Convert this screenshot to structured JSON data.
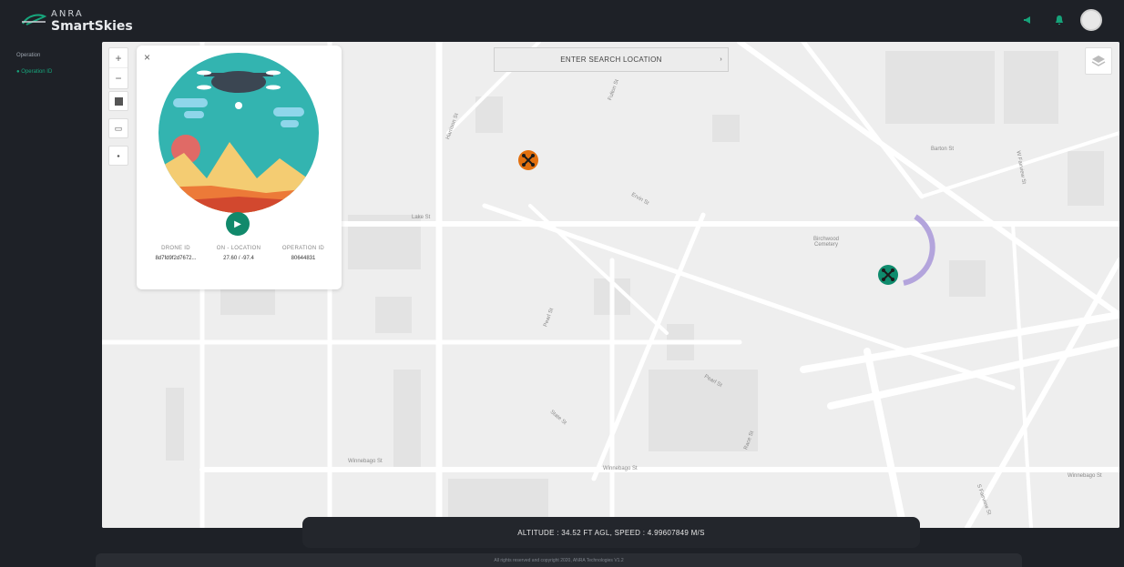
{
  "brand": {
    "line1": "ANRA",
    "line2": "SmartSkies"
  },
  "topbar": {
    "icons": [
      "megaphone-icon",
      "bell-icon"
    ],
    "accent": "#16a37a"
  },
  "sidebar": {
    "title": "Operation",
    "items": [
      {
        "label": "● Operation ID"
      }
    ]
  },
  "map": {
    "search_label": "ENTER SEARCH LOCATION",
    "streets": [
      "Lake St",
      "Winnebago St",
      "Winnebago St",
      "Pearl St",
      "Ervin St",
      "Barton St",
      "W Fairview St",
      "S Fairview St",
      "Harrison St",
      "Pearl St",
      "State St",
      "Fulton St",
      "Race St",
      "Winnebago St"
    ],
    "poi": "Birchwood Cemetery",
    "drone_colors": {
      "active": "#e2700f",
      "selected": "#0f8b6d",
      "path": "#b3a4dc"
    }
  },
  "card": {
    "close": "×",
    "fields": [
      {
        "key": "DRONE ID",
        "value": "8d7fd9f2d7672..."
      },
      {
        "key": "ON - LOCATION",
        "value": "27.60 / -97.4"
      },
      {
        "key": "OPERATION ID",
        "value": "80644831"
      }
    ]
  },
  "status": {
    "text": "ALTITUDE : 34.52 FT AGL, SPEED : 4.99607849 M/S"
  },
  "footer": {
    "text": "All rights reserved and copyright 2020, ANRA Technologies V1.2"
  }
}
